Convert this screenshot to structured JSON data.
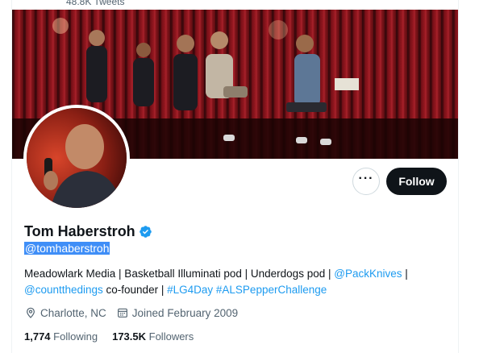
{
  "header": {
    "tweets_count": "48.8K Tweets"
  },
  "profile": {
    "name": "Tom Haberstroh",
    "handle": "@tomhaberstroh",
    "bio": {
      "seg1": "Meadowlark Media | Basketball Illuminati pod | Underdogs pod | ",
      "mention1": "@PackKnives",
      "seg2": " |",
      "mention2": "@countthedings",
      "seg3": " co-founder | ",
      "tag1": "#LG4Day",
      "seg4": " ",
      "tag2": "#ALSPepperChallenge"
    },
    "location": "Charlotte, NC",
    "joined": "Joined February 2009",
    "following_count": "1,774",
    "following_label": "Following",
    "followers_count": "173.5K",
    "followers_label": "Followers"
  },
  "actions": {
    "more_label": "···",
    "follow_label": "Follow"
  },
  "icons": {
    "verified": "verified-badge-icon",
    "location": "location-pin-icon",
    "calendar": "calendar-icon",
    "more": "more-icon"
  },
  "colors": {
    "accent": "#1d9bf0",
    "text": "#0f1419",
    "muted": "#536471",
    "follow_bg": "#0f1419",
    "selection": "#3f8ef7"
  }
}
